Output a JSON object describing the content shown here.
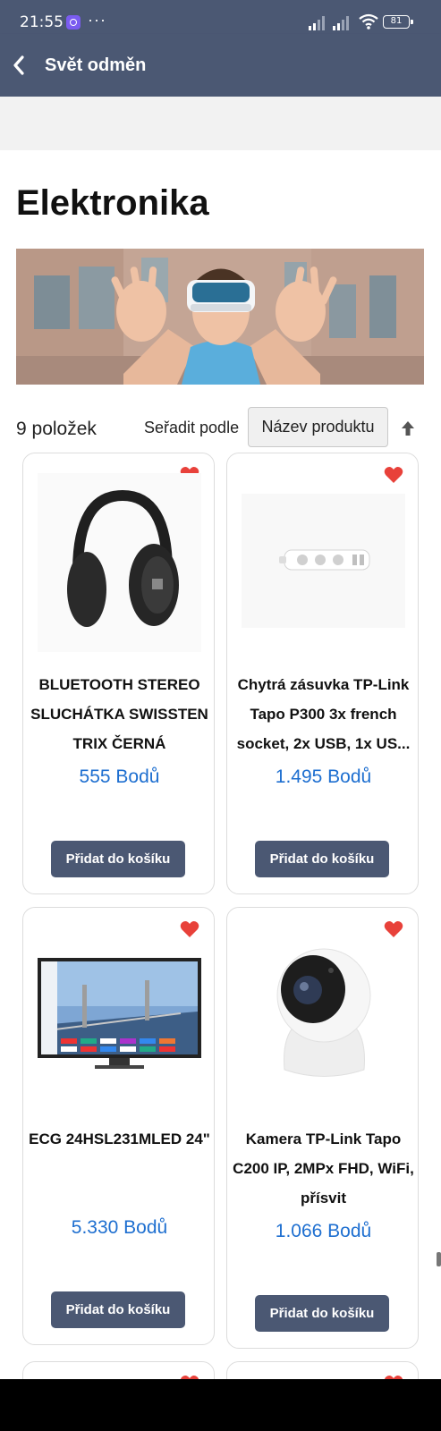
{
  "status_bar": {
    "time": "21:55",
    "more": "···",
    "battery": "81"
  },
  "header": {
    "title": "Svět odměn"
  },
  "category": {
    "title": "Elektronika"
  },
  "listing": {
    "count_label": "9 položek",
    "sort_label": "Seřadit podle",
    "sort_value": "Název produktu"
  },
  "products": [
    {
      "name": "BLUETOOTH STEREO SLUCHÁTKA SWISSTEN TRIX ČERNÁ",
      "price": "555 Bodů",
      "button": "Přidat do košíku"
    },
    {
      "name": "Chytrá zásuvka TP-Link Tapo P300 3x french socket, 2x USB, 1x US...",
      "price": "1.495 Bodů",
      "button": "Přidat do košíku"
    },
    {
      "name": "ECG 24HSL231MLED 24\"",
      "price": "5.330 Bodů",
      "button": "Přidat do košíku"
    },
    {
      "name": "Kamera TP-Link Tapo C200 IP, 2MPx FHD, WiFi, přísvit",
      "price": "1.066 Bodů",
      "button": "Přidat do košíku"
    }
  ],
  "colors": {
    "header_bg": "#4b5873",
    "price": "#1e6fd0",
    "favorite": "#e8413a"
  }
}
